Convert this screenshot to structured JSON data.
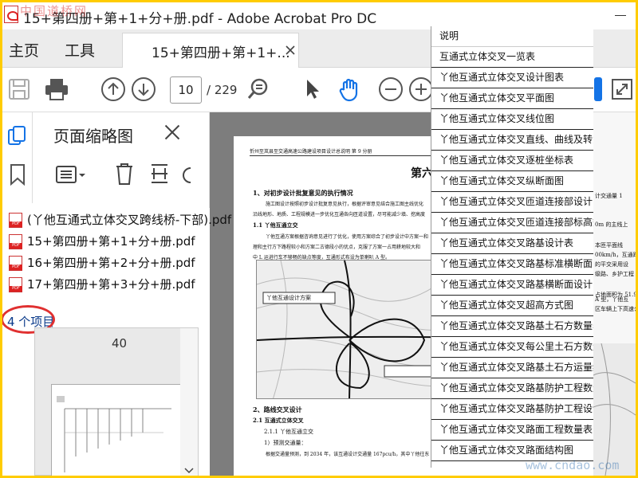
{
  "window": {
    "title": "15+第四册+第+1+分+册.pdf - Adobe Acrobat Pro DC",
    "watermark_top": "中国道桥网"
  },
  "menu": {
    "home": "主页",
    "tools": "工具",
    "doc_tab": "15+第四册+第+1+..."
  },
  "toolbar": {
    "page_current": "10",
    "page_total": "/ 229"
  },
  "thumbnails": {
    "title": "页面缩略图",
    "page_label": "40"
  },
  "explorer": {
    "files": [
      "(丫他互通式立体交叉跨线桥-下部).pdf",
      "15+第四册+第+1+分+册.pdf",
      "16+第四册+第+2+分+册.pdf",
      "17+第四册+第+3+分+册.pdf"
    ],
    "item_count": "4 个项目"
  },
  "document": {
    "header": "忻州至岚县至交通高速公路建设项目设计总说明  第 9 分册",
    "chapter": "第六",
    "section1": "1、对初步设计批复意见的执行情况",
    "para1": "施工图设计按照初步设计批复意见执行，根据评审意见结合施工图主线优化",
    "para2": "沿线地形、地质、工程规模进一步优化互通各向匝道设置，尽可能减少填、挖高度",
    "sub1": "1.1 丫他互通立交",
    "para3": "丫他互通方案根据咨询意见进行了优化，使用方案综合了初步设计中方案一和",
    "para4": "理和主行方下路程较小和方案二古德段小的优点，克服了方案一占用耕地较大和",
    "para5": "中 L 运进行车不够畅的缺点等度，互通形式布设为单喇叭 A 型。",
    "section2": "2、路线交叉设计",
    "sub2": "2.1 互通式立体交叉",
    "sub3": "2.1.1 丫他互通立交",
    "sub4": "1）预测交通量：",
    "para6": "根据交通量预测，到 2034 年，该互通设计交通量 167pcu/h，其中丫他往东",
    "drawing_label": "丫他互通设计方案"
  },
  "toc": [
    "说明",
    "互通式立体交叉一览表",
    "丫他互通式立体交叉设计图表",
    "丫他互通式立体交叉平面图",
    "丫他互通式立体交叉线位图",
    "丫他互通式立体交叉直线、曲线及转角表",
    "丫他互通式立体交叉逐桩坐标表",
    "丫他互通式立体交叉纵断面图",
    "丫他互通式立体交叉匝道连接部设计图",
    "丫他互通式立体交叉匝道连接部标高数据图",
    "丫他互通式立体交叉路基设计表",
    "丫他互通式立体交叉路基标准横断面图",
    "丫他互通式立体交叉路基横断面设计图",
    "丫他互通式立体交叉超高方式图",
    "丫他互通式立体交叉路基土石方数量表",
    "丫他互通式立体交叉每公里土石方数量表",
    "丫他互通式立体交叉路基土石方运量统计表",
    "丫他互通式立体交叉路基防护工程数量表",
    "丫他互通式立体交叉路基防护工程设计图",
    "丫他互通式立体交叉路面工程数量表",
    "丫他互通式立体交叉路面结构图"
  ],
  "right_snippets": [
    "计交通量 1",
    "0m 的主线上",
    "本匝平面线",
    "00km/h，互通距",
    "的平交采用设",
    "级路、乡护工程",
    "占地面积为 51.9",
    "A 型，丫他互",
    "区车辆上下高速公路"
  ],
  "watermark_bottom": "www.cndao.com",
  "colors": {
    "accent_blue": "#1473e6",
    "highlight_red": "#e03030",
    "frame_yellow": "#ffcc00"
  }
}
